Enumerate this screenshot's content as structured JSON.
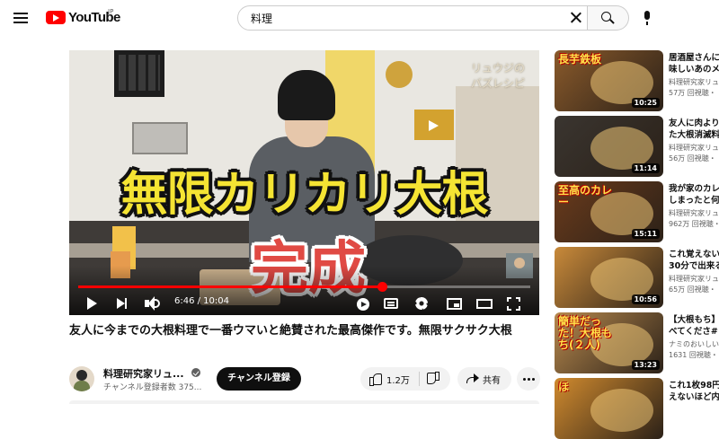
{
  "header": {
    "logo_text": "YouTube",
    "logo_region": "JP",
    "search_value": "料理"
  },
  "player": {
    "channel_watermark": "リュウジの\nバズレシピ",
    "caption_main": "無限カリカリ大根",
    "caption_done": "完成",
    "current_time": "6:46",
    "duration": "10:04",
    "time_display": "6:46 / 10:04",
    "progress_fraction": 0.672,
    "progress_color": "#ff0000"
  },
  "video": {
    "title": "友人に今までの大根料理で一番ウマいと絶賛された最高傑作です。無限サクサク大根",
    "channel_name": "料理研究家リュ...",
    "subscribers": "チャンネル登録者数 375...",
    "subscribe_label": "チャンネル登録",
    "like_count": "1.2万",
    "share_label": "共有"
  },
  "related": [
    {
      "title_line1": "居酒屋さんに",
      "title_line2": "味しいあのメ",
      "channel": "料理研究家リュ",
      "views": "57万 回視聴・",
      "duration": "10:25",
      "thumb_text": "長芋鉄板",
      "thumb_color": "#8a5a2b"
    },
    {
      "title_line1": "友人に肉より",
      "title_line2": "た大根消滅料",
      "channel": "料理研究家リュ",
      "views": "56万 回視聴・",
      "duration": "11:14",
      "thumb_text": "",
      "thumb_color": "#3a3530"
    },
    {
      "title_line1": "我が家のカレ",
      "title_line2": "しまったと何",
      "channel": "料理研究家リュ",
      "views": "962万 回視聴・",
      "duration": "15:11",
      "thumb_text": "至高のカレー",
      "thumb_color": "#6b3b1c"
    },
    {
      "title_line1": "これ覚えない",
      "title_line2": "30分で出来る",
      "channel": "料理研究家リュ",
      "views": "65万 回視聴・",
      "duration": "10:56",
      "thumb_text": "",
      "thumb_color": "#c98a3a"
    },
    {
      "title_line1": "【大根もち】",
      "title_line2": "べてくださ#",
      "channel": "ナミのおいしい",
      "views": "1631 回視聴・",
      "duration": "13:23",
      "thumb_text": "簡単だった！大根もち(２人)",
      "thumb_color": "#b7894e"
    },
    {
      "title_line1": "これ1枚98円",
      "title_line2": "えないほど内",
      "channel": "",
      "views": "",
      "duration": "",
      "thumb_text": "ほ",
      "thumb_color": "#d08a2e"
    }
  ]
}
